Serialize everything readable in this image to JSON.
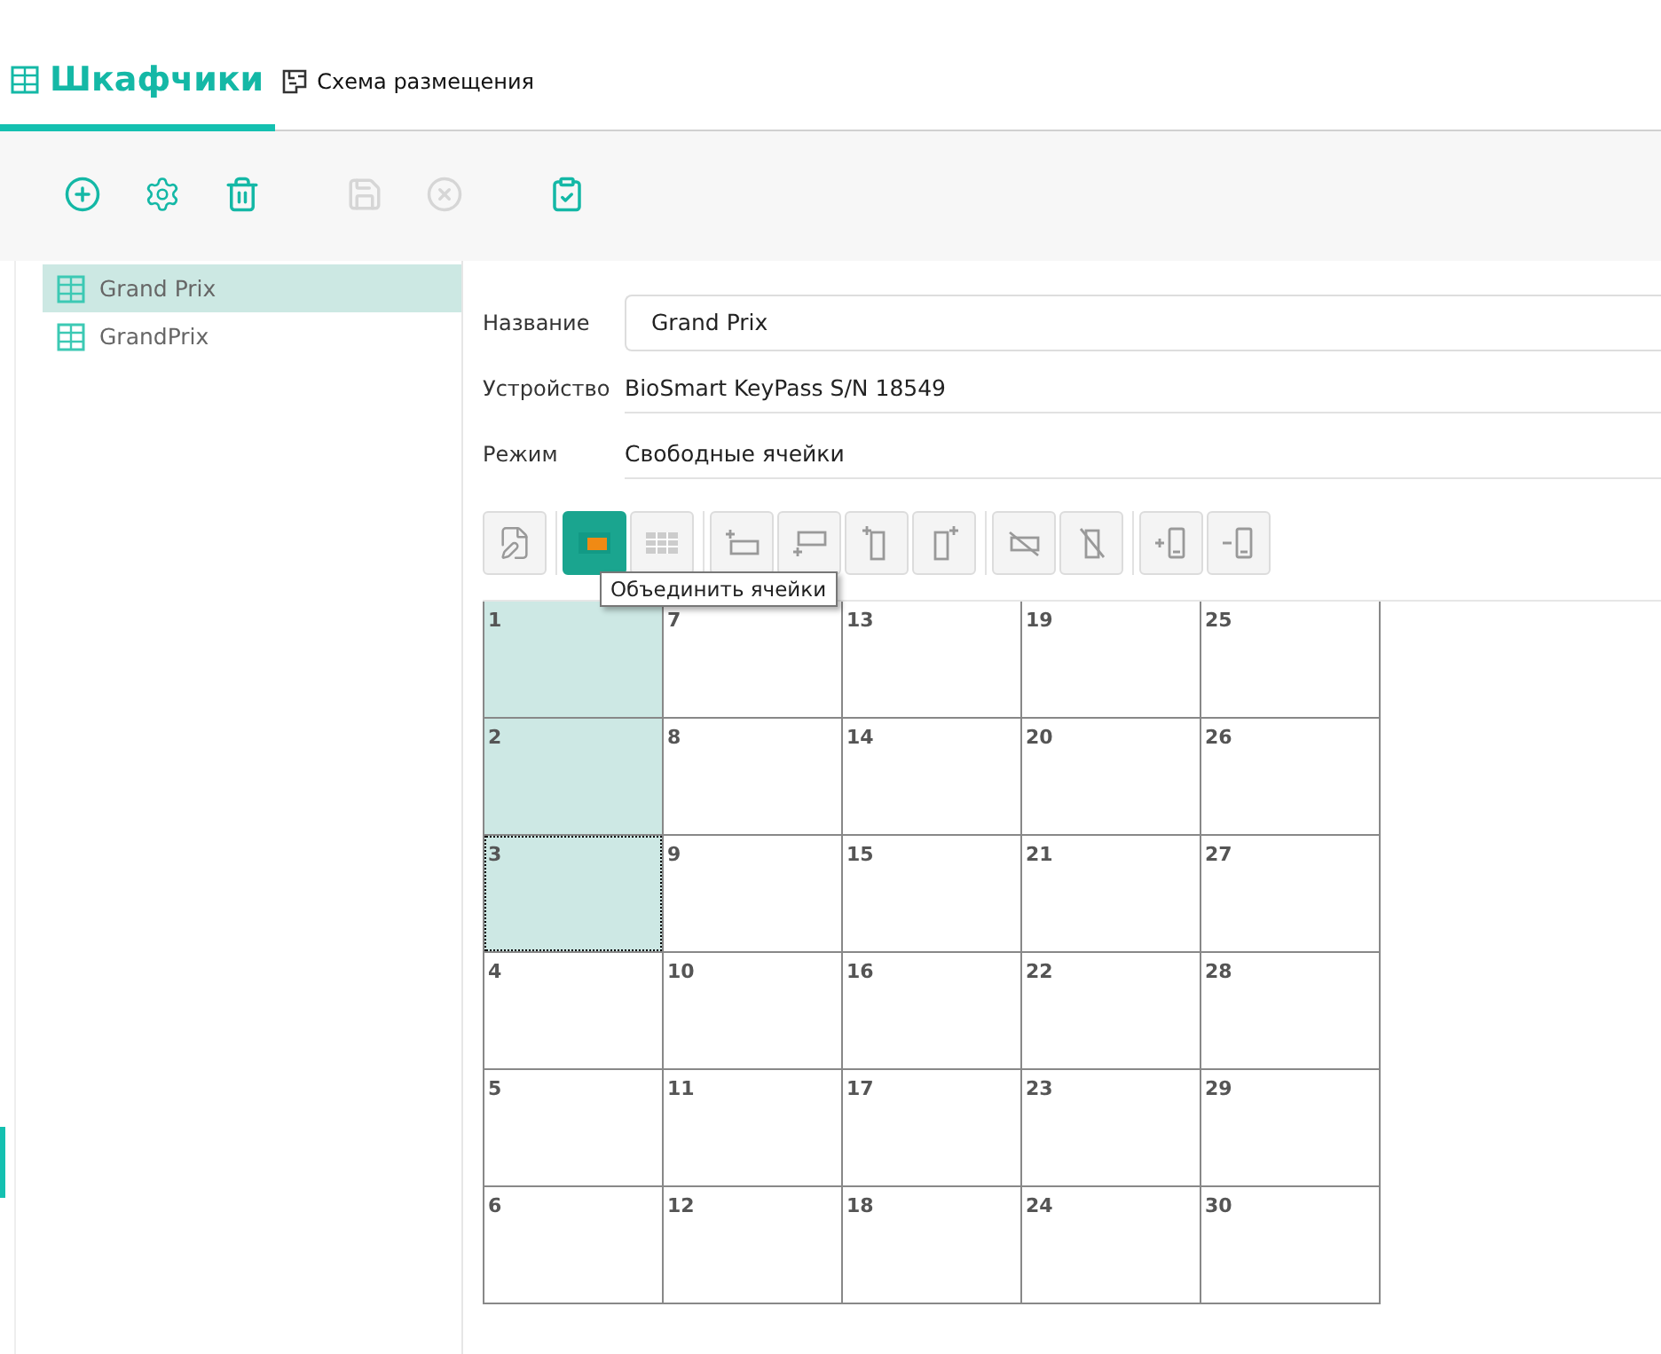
{
  "tabs": [
    {
      "label": "Шкафчики",
      "selected": true
    },
    {
      "label": "Схема размещения",
      "selected": false
    }
  ],
  "toolbar": [
    {
      "kind": "add",
      "disabled": false
    },
    {
      "kind": "settings",
      "disabled": false
    },
    {
      "kind": "delete",
      "disabled": false
    },
    {
      "kind": "save",
      "disabled": true
    },
    {
      "kind": "cancel",
      "disabled": true
    },
    {
      "kind": "checklist",
      "disabled": false
    }
  ],
  "list": [
    {
      "label": "Grand Prix",
      "selected": true
    },
    {
      "label": "GrandPrix",
      "selected": false
    }
  ],
  "form": {
    "name": {
      "label": "Название",
      "value": "Grand Prix"
    },
    "device": {
      "label": "Устройство",
      "value": "BioSmart KeyPass S/N 18549"
    },
    "mode": {
      "label": "Режим",
      "value": "Свободные ячейки"
    }
  },
  "grid_tools": [
    {
      "kind": "edit",
      "active": false
    },
    {
      "kind": "merge",
      "active": true
    },
    {
      "kind": "split",
      "active": false
    },
    {
      "kind": "row-above",
      "active": false
    },
    {
      "kind": "row-below",
      "active": false
    },
    {
      "kind": "col-left",
      "active": false
    },
    {
      "kind": "col-right",
      "active": false
    },
    {
      "kind": "del-row",
      "active": false
    },
    {
      "kind": "del-col",
      "active": false
    },
    {
      "kind": "plus",
      "active": false
    },
    {
      "kind": "minus",
      "active": false
    }
  ],
  "tooltip": "Объединить ячейки",
  "cells": [
    {
      "label": "1",
      "selected": true,
      "focused": false
    },
    {
      "label": "2",
      "selected": true,
      "focused": false
    },
    {
      "label": "3",
      "selected": true,
      "focused": true
    },
    {
      "label": "4",
      "selected": false,
      "focused": false
    },
    {
      "label": "5",
      "selected": false,
      "focused": false
    },
    {
      "label": "6",
      "selected": false,
      "focused": false
    },
    {
      "label": "7",
      "selected": false,
      "focused": false
    },
    {
      "label": "8",
      "selected": false,
      "focused": false
    },
    {
      "label": "9",
      "selected": false,
      "focused": false
    },
    {
      "label": "10",
      "selected": false,
      "focused": false
    },
    {
      "label": "11",
      "selected": false,
      "focused": false
    },
    {
      "label": "12",
      "selected": false,
      "focused": false
    },
    {
      "label": "13",
      "selected": false,
      "focused": false
    },
    {
      "label": "14",
      "selected": false,
      "focused": false
    },
    {
      "label": "15",
      "selected": false,
      "focused": false
    },
    {
      "label": "16",
      "selected": false,
      "focused": false
    },
    {
      "label": "17",
      "selected": false,
      "focused": false
    },
    {
      "label": "18",
      "selected": false,
      "focused": false
    },
    {
      "label": "19",
      "selected": false,
      "focused": false
    },
    {
      "label": "20",
      "selected": false,
      "focused": false
    },
    {
      "label": "21",
      "selected": false,
      "focused": false
    },
    {
      "label": "22",
      "selected": false,
      "focused": false
    },
    {
      "label": "23",
      "selected": false,
      "focused": false
    },
    {
      "label": "24",
      "selected": false,
      "focused": false
    },
    {
      "label": "25",
      "selected": false,
      "focused": false
    },
    {
      "label": "26",
      "selected": false,
      "focused": false
    },
    {
      "label": "27",
      "selected": false,
      "focused": false
    },
    {
      "label": "28",
      "selected": false,
      "focused": false
    },
    {
      "label": "29",
      "selected": false,
      "focused": false
    },
    {
      "label": "30",
      "selected": false,
      "focused": false
    }
  ]
}
